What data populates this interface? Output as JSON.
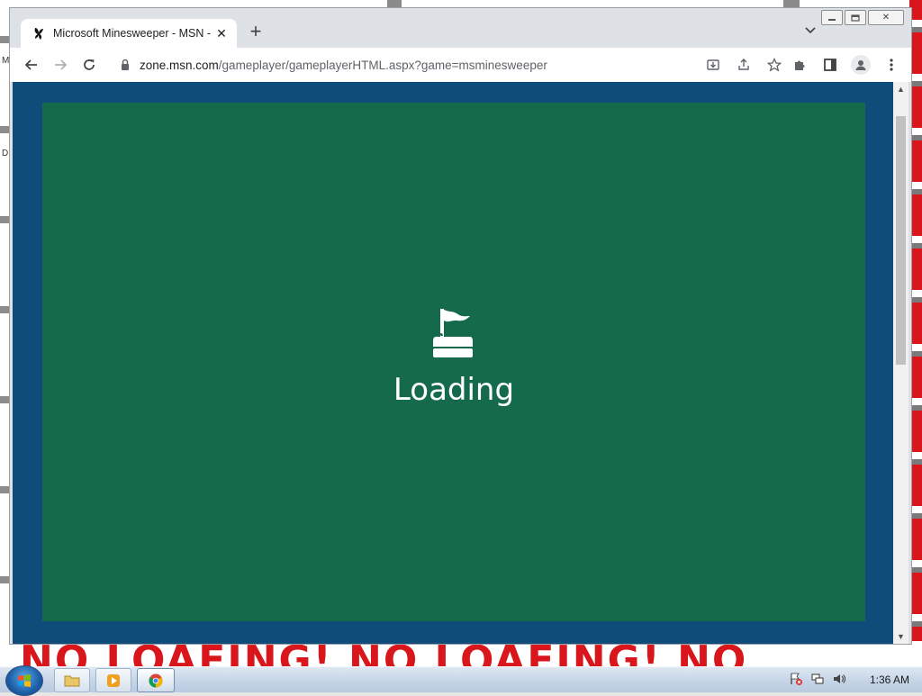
{
  "browser": {
    "tab_title": "Microsoft Minesweeper - MSN",
    "tab_title_suffix": " -",
    "new_tab_label": "+",
    "url_host": "zone.msn.com",
    "url_path": "/gameplayer/gameplayerHTML.aspx?game=msminesweeper"
  },
  "page": {
    "loading_text": "Loading"
  },
  "desktop": {
    "banner_text": "NO LOAFING! NO LOAFING! NO",
    "edge_letter_top": "M",
    "edge_letter_mid": "D"
  },
  "taskbar": {
    "clock": "1:36 AM"
  },
  "colors": {
    "viewport_bg": "#0f4c7a",
    "game_bg": "#166a4c",
    "banner_red": "#d8161b"
  }
}
